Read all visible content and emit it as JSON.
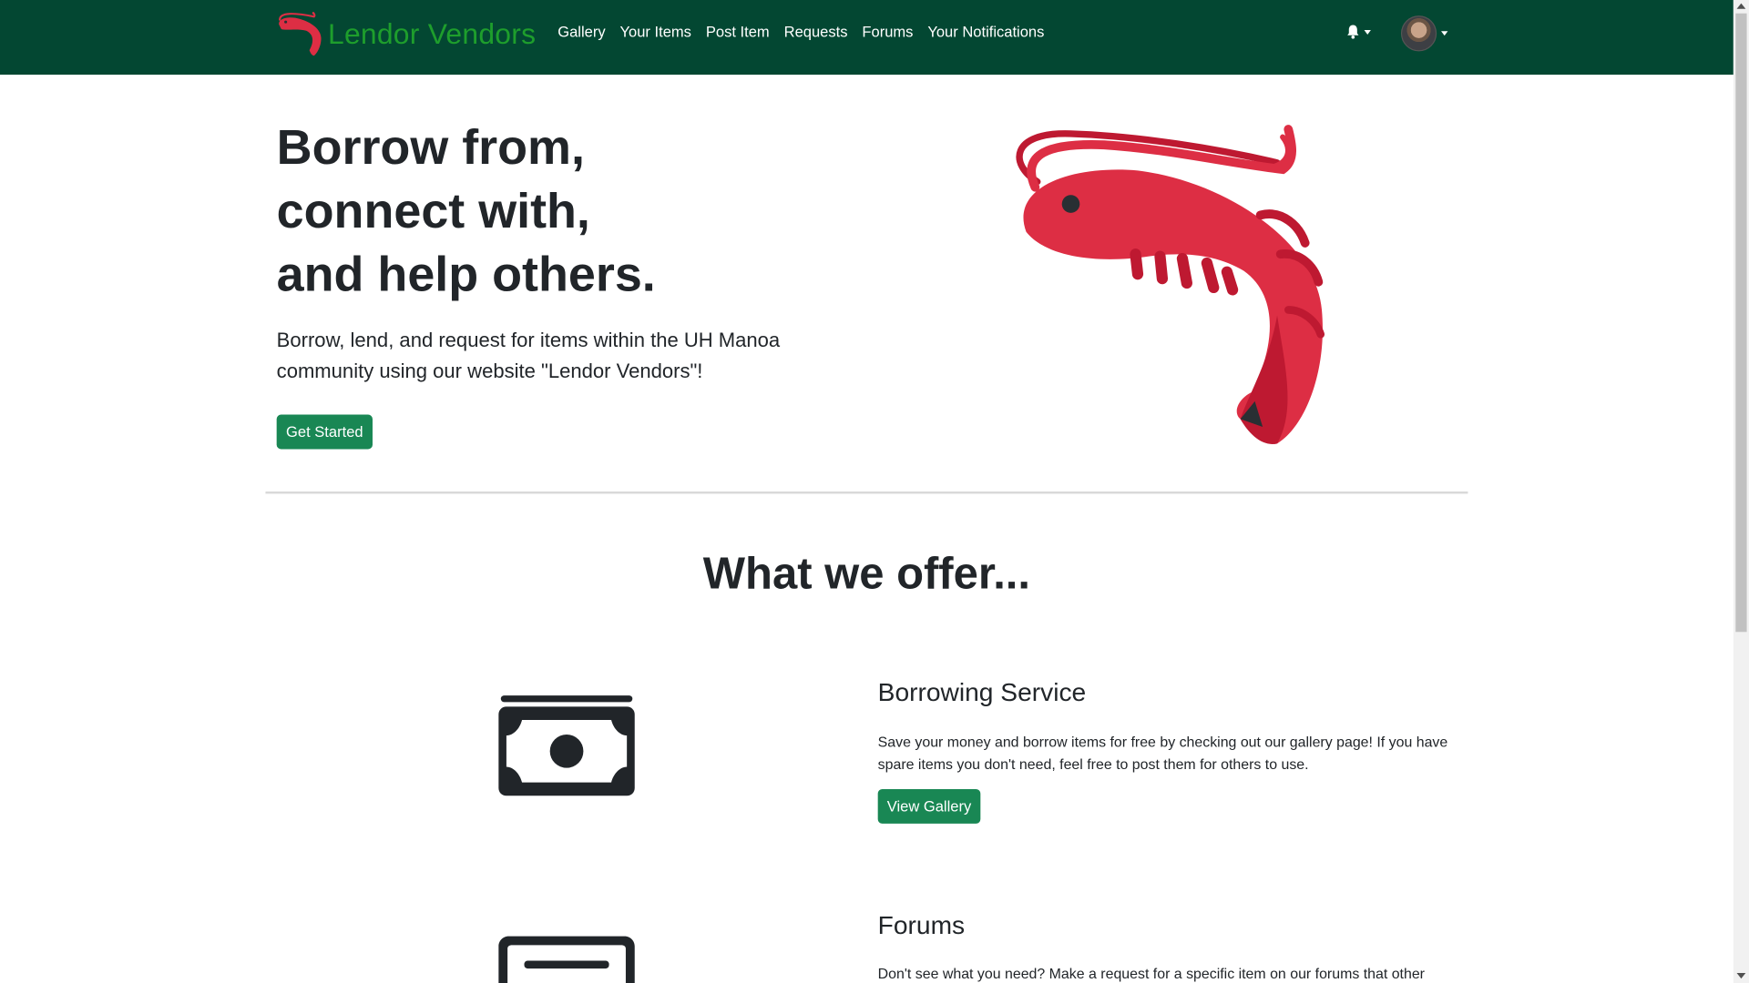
{
  "navbar": {
    "brand": "Lendor Vendors",
    "links": [
      "Gallery",
      "Your Items",
      "Post Item",
      "Requests",
      "Forums",
      "Your Notifications"
    ]
  },
  "hero": {
    "title": "Borrow from,\nconnect with,\nand help others.",
    "subtitle": "Borrow, lend, and request for items within the UH Manoa community using our website \"Lendor Vendors\"!",
    "cta": "Get Started"
  },
  "offers": {
    "heading": "What we offer...",
    "items": [
      {
        "title": "Borrowing Service",
        "description": "Save your money and borrow items for free by checking out our gallery page! If you have spare items you don't need, feel free to post them for others to use.",
        "button": "View Gallery",
        "icon": "money-icon"
      },
      {
        "title": "Forums",
        "description": "Don't see what you need? Make a request for a specific item on our forums that other",
        "icon": "card-icon"
      }
    ]
  },
  "colors": {
    "navbar": "#034732",
    "brand": "#1e9e2c",
    "button": "#198754",
    "shrimp": "#dd2e44"
  }
}
